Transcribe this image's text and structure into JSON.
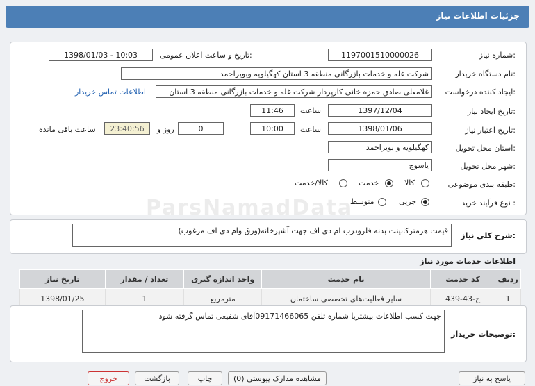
{
  "header": {
    "title": "جزئیات اطلاعات نیاز"
  },
  "form": {
    "need_number_label": "شماره نیاز:",
    "need_number": "1197001510000026",
    "announce_label": "تاریخ و ساعت اعلان عمومی:",
    "announce_value": "1398/01/03 - 10:03",
    "buyer_org_label": "نام دستگاه خریدار:",
    "buyer_org": "شرکت غله و خدمات بازرگانی منطقه 3 استان کهگیلویه وبویراحمد",
    "requester_label": "ایجاد کننده درخواست:",
    "requester": "غلامعلی صادق حمزه خانی کارپرداز شرکت غله و خدمات بازرگانی منطقه 3 استان",
    "contact_link": "اطلاعات تماس خریدار",
    "created_label": "تاریخ ایجاد نیاز:",
    "created_date": "1397/12/04",
    "time_label": "ساعت",
    "created_time": "11:46",
    "validity_label": "تاریخ اعتبار نیاز:",
    "validity_date": "1398/01/06",
    "validity_time": "10:00",
    "days_value": "0",
    "days_label": "روز و",
    "remaining_time": "23:40:56",
    "remaining_label": "ساعت باقی مانده",
    "province_label": "استان محل تحویل:",
    "province": "کهگیلویه و بویراحمد",
    "city_label": "شهر محل تحویل:",
    "city": "یاسوج",
    "category_label": "طبقه بندی موضوعی:",
    "category_options": [
      "کالا",
      "خدمت",
      "کالا/خدمت"
    ],
    "process_label": "نوع فرآیند خرید :",
    "process_options": [
      "جزیی",
      "متوسط"
    ]
  },
  "summary": {
    "label": "شرح کلی نیاز:",
    "text": "قیمت هرمترکابینت بدنه فلزودرب ام دی اف جهت آشپزخانه(ورق وام دی اف مرغوب)"
  },
  "services": {
    "title": "اطلاعات خدمات مورد نیاز",
    "headers": [
      "ردیف",
      "کد خدمت",
      "نام خدمت",
      "واحد اندازه گیری",
      "تعداد / مقدار",
      "تاریخ نیاز"
    ],
    "rows": [
      [
        "1",
        "ج-43-439",
        "سایر فعالیت‌های تخصصی ساختمان",
        "مترمربع",
        "1",
        "1398/01/25"
      ]
    ]
  },
  "buyer_notes": {
    "label": "توضیحات خریدار:",
    "text": "جهت کسب اطلاعات بیشتربا شماره تلفن 09171466065آقای شفیعی تماس گرفته شود"
  },
  "watermark": {
    "text": "ParsNamadData"
  },
  "buttons": {
    "reply": "پاسخ به نیاز",
    "docs": "مشاهده مدارک پیوستی (0)",
    "print": "چاپ",
    "back": "بازگشت",
    "exit": "خروج"
  }
}
